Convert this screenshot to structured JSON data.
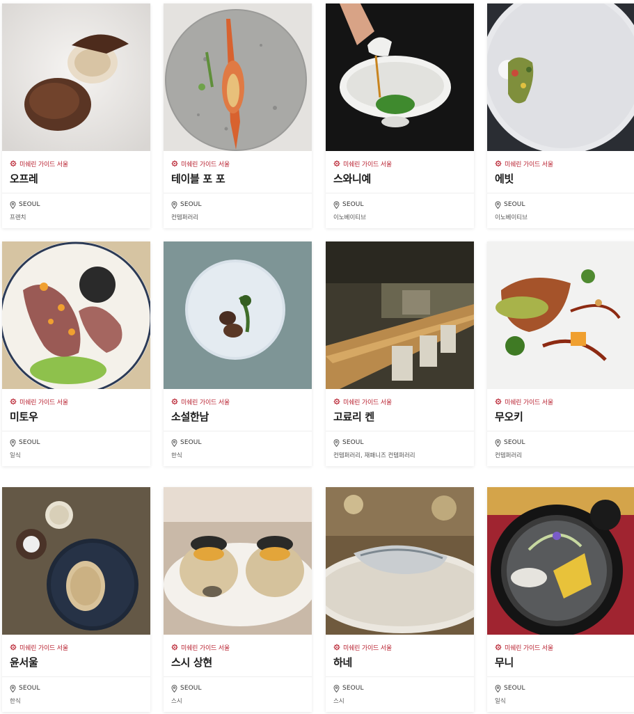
{
  "guide_label": "미쉐린 가이드 서울",
  "colors": {
    "accent": "#b8202f"
  },
  "restaurants": [
    {
      "name": "오프레",
      "city": "SEOUL",
      "cuisine": "프렌치"
    },
    {
      "name": "테이블 포 포",
      "city": "SEOUL",
      "cuisine": "컨템퍼러리"
    },
    {
      "name": "스와니예",
      "city": "SEOUL",
      "cuisine": "이노베이티브"
    },
    {
      "name": "에빗",
      "city": "SEOUL",
      "cuisine": "이노베이티브"
    },
    {
      "name": "미토우",
      "city": "SEOUL",
      "cuisine": "일식"
    },
    {
      "name": "소설한남",
      "city": "SEOUL",
      "cuisine": "한식"
    },
    {
      "name": "고료리 켄",
      "city": "SEOUL",
      "cuisine": "컨템퍼러리, 재패니즈 컨템퍼러리"
    },
    {
      "name": "무오키",
      "city": "SEOUL",
      "cuisine": "컨템퍼러리"
    },
    {
      "name": "윤서울",
      "city": "SEOUL",
      "cuisine": "한식"
    },
    {
      "name": "스시 상현",
      "city": "SEOUL",
      "cuisine": "스시"
    },
    {
      "name": "하네",
      "city": "SEOUL",
      "cuisine": "스시"
    },
    {
      "name": "무니",
      "city": "SEOUL",
      "cuisine": "일식"
    }
  ]
}
